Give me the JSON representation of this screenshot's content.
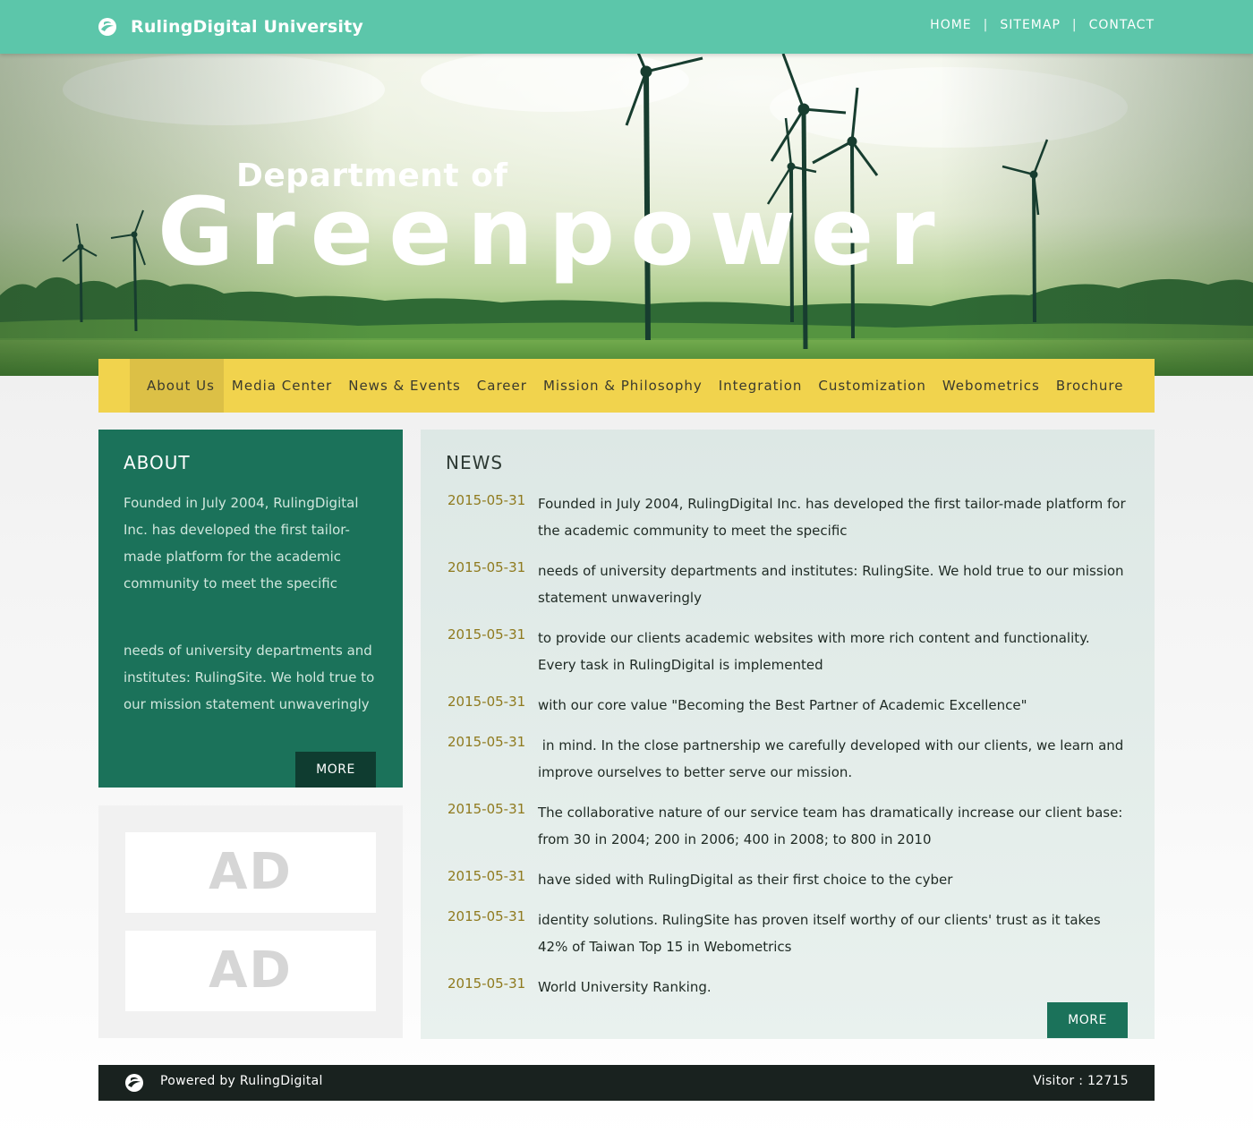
{
  "header": {
    "site_name": "RulingDigital University",
    "links": [
      "HOME",
      "SITEMAP",
      "CONTACT"
    ],
    "separator": "|"
  },
  "hero": {
    "subtitle": "Department of",
    "title": "Greenpower"
  },
  "nav": {
    "items": [
      "About Us",
      "Media Center",
      "News & Events",
      "Career",
      "Mission & Philosophy",
      "Integration",
      "Customization",
      "Webometrics",
      "Brochure"
    ],
    "active": "About Us"
  },
  "about": {
    "heading": "ABOUT",
    "paragraph1": "Founded in July 2004, RulingDigital Inc. has developed the first tailor-made platform for the academic community to meet the specific",
    "paragraph2": "needs of university departments and institutes: RulingSite. We hold true to our mission statement unwaveringly",
    "more_label": "MORE"
  },
  "ads": [
    "AD",
    "AD"
  ],
  "news": {
    "heading": "NEWS",
    "items": [
      {
        "date": "2015-05-31",
        "text": "Founded in July 2004, RulingDigital Inc. has developed the first tailor-made platform for the academic community to meet the specific"
      },
      {
        "date": "2015-05-31",
        "text": "needs of university departments and institutes: RulingSite. We hold true to our mission statement unwaveringly"
      },
      {
        "date": "2015-05-31",
        "text": "to provide our clients academic websites with more rich content and functionality. Every task in RulingDigital is implemented"
      },
      {
        "date": "2015-05-31",
        "text": "with our core value \"Becoming the Best Partner of Academic Excellence\""
      },
      {
        "date": "2015-05-31",
        "text": " in mind. In the close partnership we carefully developed with our clients, we learn and improve ourselves to better serve our mission."
      },
      {
        "date": "2015-05-31",
        "text": "The collaborative nature of our service team has dramatically increase our client base: from 30 in 2004; 200 in 2006; 400 in 2008; to 800 in 2010"
      },
      {
        "date": "2015-05-31",
        "text": "have sided with RulingDigital as their first choice to the cyber"
      },
      {
        "date": "2015-05-31",
        "text": "identity solutions. RulingSite has proven itself worthy of our clients' trust as it takes 42% of Taiwan Top 15 in Webometrics"
      },
      {
        "date": "2015-05-31",
        "text": "World University Ranking."
      }
    ],
    "more_label": "MORE"
  },
  "footer": {
    "powered": "Powered by RulingDigital",
    "visitor": "Visitor : 12715"
  },
  "colors": {
    "header": "#5cc6aa",
    "nav": "#f1d34d",
    "about_bg": "#1b725a",
    "footer": "#19221f",
    "date": "#8f7a1e"
  },
  "icons": {
    "logo": "globe-logo-icon"
  }
}
